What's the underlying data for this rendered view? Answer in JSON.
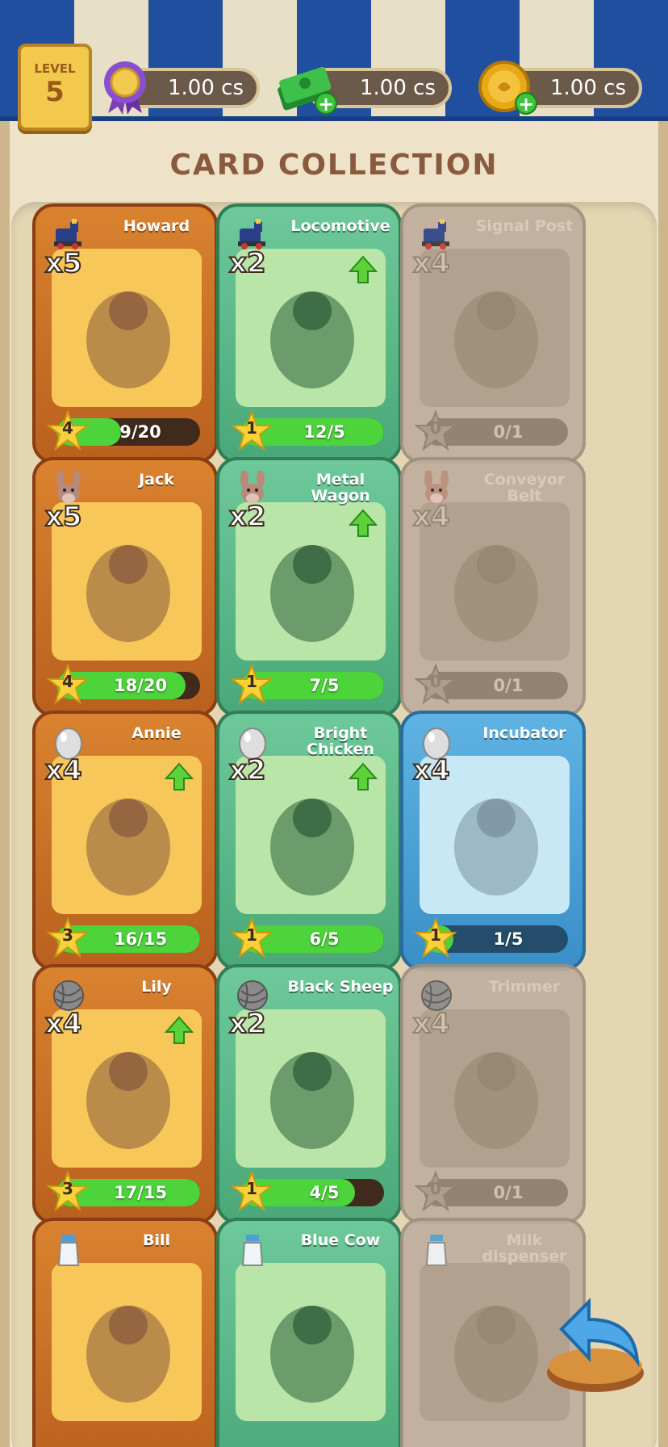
{
  "header": {
    "level_label": "LEVEL",
    "level_value": "5",
    "currencies": [
      {
        "icon": "ribbon-medal-icon",
        "value": "1.00 cs"
      },
      {
        "icon": "cash-stack-icon",
        "value": "1.00 cs"
      },
      {
        "icon": "gold-coin-icon",
        "value": "1.00 cs"
      }
    ]
  },
  "title": "CARD COLLECTION",
  "cards": [
    {
      "name": "Howard",
      "mult": "x5",
      "stars": "4",
      "progress": "9/20",
      "fill": 0.45,
      "style": "wood",
      "icon": "train-icon",
      "upgrade": false
    },
    {
      "name": "Locomotive",
      "mult": "x2",
      "stars": "1",
      "progress": "12/5",
      "fill": 1.0,
      "style": "green",
      "icon": "train-icon",
      "upgrade": true
    },
    {
      "name": "Signal Post",
      "mult": "x4",
      "stars": "0",
      "progress": "0/1",
      "fill": 0,
      "style": "gray",
      "icon": "train-icon",
      "upgrade": false
    },
    {
      "name": "Jack",
      "mult": "x5",
      "stars": "4",
      "progress": "18/20",
      "fill": 0.9,
      "style": "wood",
      "icon": "donkey-icon",
      "upgrade": false
    },
    {
      "name": "Metal Wagon",
      "mult": "x2",
      "stars": "1",
      "progress": "7/5",
      "fill": 1.0,
      "style": "green",
      "icon": "donkey-icon",
      "upgrade": true
    },
    {
      "name": "Conveyor Belt",
      "mult": "x4",
      "stars": "0",
      "progress": "0/1",
      "fill": 0,
      "style": "gray",
      "icon": "donkey-icon",
      "upgrade": false
    },
    {
      "name": "Annie",
      "mult": "x4",
      "stars": "3",
      "progress": "16/15",
      "fill": 1.0,
      "style": "wood",
      "icon": "egg-icon",
      "upgrade": true
    },
    {
      "name": "Bright Chicken",
      "mult": "x2",
      "stars": "1",
      "progress": "6/5",
      "fill": 1.0,
      "style": "green",
      "icon": "egg-icon",
      "upgrade": true
    },
    {
      "name": "Incubator",
      "mult": "x4",
      "stars": "1",
      "progress": "1/5",
      "fill": 0.2,
      "style": "blue",
      "icon": "egg-icon",
      "upgrade": false
    },
    {
      "name": "Lily",
      "mult": "x4",
      "stars": "3",
      "progress": "17/15",
      "fill": 1.0,
      "style": "wood",
      "icon": "yarn-ball-icon",
      "upgrade": true
    },
    {
      "name": "Black Sheep",
      "mult": "x2",
      "stars": "1",
      "progress": "4/5",
      "fill": 0.8,
      "style": "green",
      "icon": "yarn-ball-icon",
      "upgrade": false
    },
    {
      "name": "Trimmer",
      "mult": "x4",
      "stars": "0",
      "progress": "0/1",
      "fill": 0,
      "style": "gray",
      "icon": "yarn-ball-icon",
      "upgrade": false
    },
    {
      "name": "Bill",
      "mult": "",
      "stars": "",
      "progress": "",
      "fill": 0,
      "style": "wood",
      "icon": "milk-bottle-icon",
      "upgrade": false
    },
    {
      "name": "Blue Cow",
      "mult": "",
      "stars": "",
      "progress": "",
      "fill": 0,
      "style": "green",
      "icon": "milk-bottle-icon",
      "upgrade": false
    },
    {
      "name": "Milk dispenser",
      "mult": "",
      "stars": "",
      "progress": "",
      "fill": 0,
      "style": "gray",
      "icon": "milk-bottle-icon",
      "upgrade": false
    }
  ],
  "colors": {
    "wood": "#c8702a",
    "green": "#5bb888",
    "blue": "#4aa0d6",
    "locked": "#bfae9c",
    "progress": "#4cd43a"
  }
}
